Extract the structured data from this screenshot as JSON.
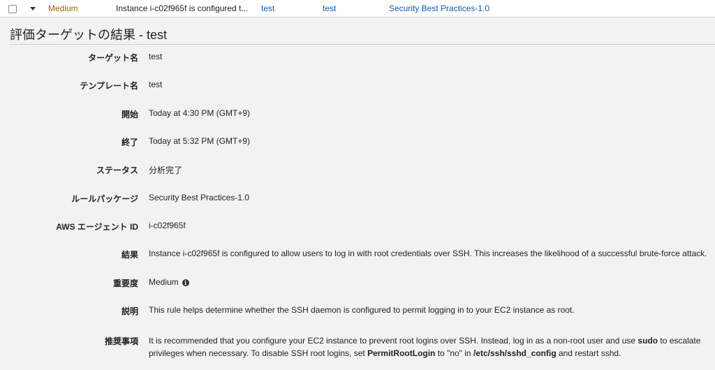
{
  "top_row": {
    "severity": "Medium",
    "finding": "Instance i-c02f965f is configured t...",
    "target": "test",
    "template": "test",
    "rules_package": "Security Best Practices-1.0"
  },
  "section_title": "評価ターゲットの結果 - test",
  "details": {
    "target_label": "ターゲット名",
    "target_value": "test",
    "template_label": "テンプレート名",
    "template_value": "test",
    "start_label": "開始",
    "start_value": "Today at 4:30 PM (GMT+9)",
    "end_label": "終了",
    "end_value": "Today at 5:32 PM (GMT+9)",
    "status_label": "ステータス",
    "status_value": "分析完了",
    "package_label": "ルールパッケージ",
    "package_value": "Security Best Practices-1.0",
    "agent_label": "AWS エージェント ID",
    "agent_value": "i-c02f965f",
    "result_label": "結果",
    "result_value": "Instance i-c02f965f is configured to allow users to log in with root credentials over SSH. This increases the likelihood of a successful brute-force attack.",
    "severity_label": "重要度",
    "severity_value": "Medium",
    "severity_info_icon": "info-circle-icon",
    "description_label": "説明",
    "description_value": "This rule helps determine whether the SSH daemon is configured to permit logging in to your EC2 instance as root.",
    "recommendation_label": "推奨事項",
    "recommendation_part1": "It is recommended that you configure your EC2 instance to prevent root logins over SSH. Instead, log in as a non-root user and use ",
    "recommendation_sudo": "sudo",
    "recommendation_part2": " to escalate privileges when necessary. To disable SSH root logins, set ",
    "recommendation_setting": "PermitRootLogin",
    "recommendation_part3": " to \"no\" in ",
    "recommendation_file": "/etc/ssh/sshd_config",
    "recommendation_part4": " and restart sshd."
  },
  "colors": {
    "link": "#0b5cad",
    "severity_medium": "#a15c00",
    "background": "#f2f2f2"
  }
}
